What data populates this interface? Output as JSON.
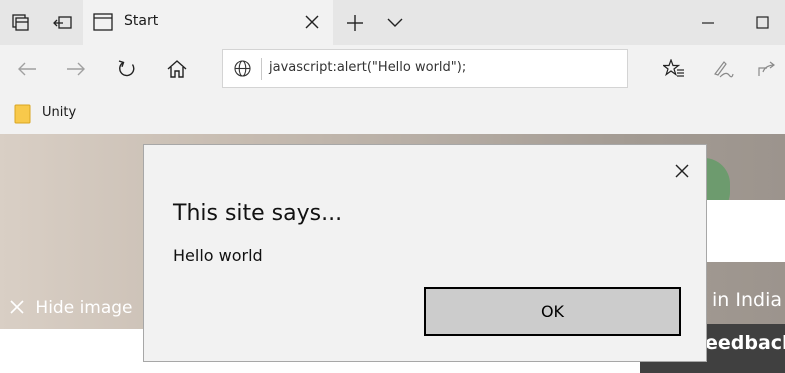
{
  "browser": {
    "tab": {
      "title": "Start"
    },
    "address_bar": {
      "value": "javascript:alert(\"Hello world\");"
    },
    "favorites": [
      {
        "label": "Unity"
      }
    ]
  },
  "page": {
    "hide_image_label": "Hide image",
    "headline_partial": "in India",
    "feedback_partial": "eedback",
    "colors": {
      "dialog_bg": "#f2f2f2",
      "ok_button_bg": "#cccccc",
      "chrome_bg": "#f2f2f2"
    }
  },
  "dialog": {
    "title": "This site says...",
    "message": "Hello world",
    "ok_label": "OK"
  },
  "icons": [
    "tab-manager-icon",
    "back-tabs-icon",
    "tab-page-icon",
    "close-icon",
    "plus-icon",
    "chevron-down-icon",
    "minimize-icon",
    "maximize-icon",
    "back-arrow-icon",
    "forward-arrow-icon",
    "refresh-icon",
    "home-icon",
    "globe-icon",
    "favorites-star-icon",
    "pen-icon",
    "share-icon",
    "folder-icon"
  ]
}
